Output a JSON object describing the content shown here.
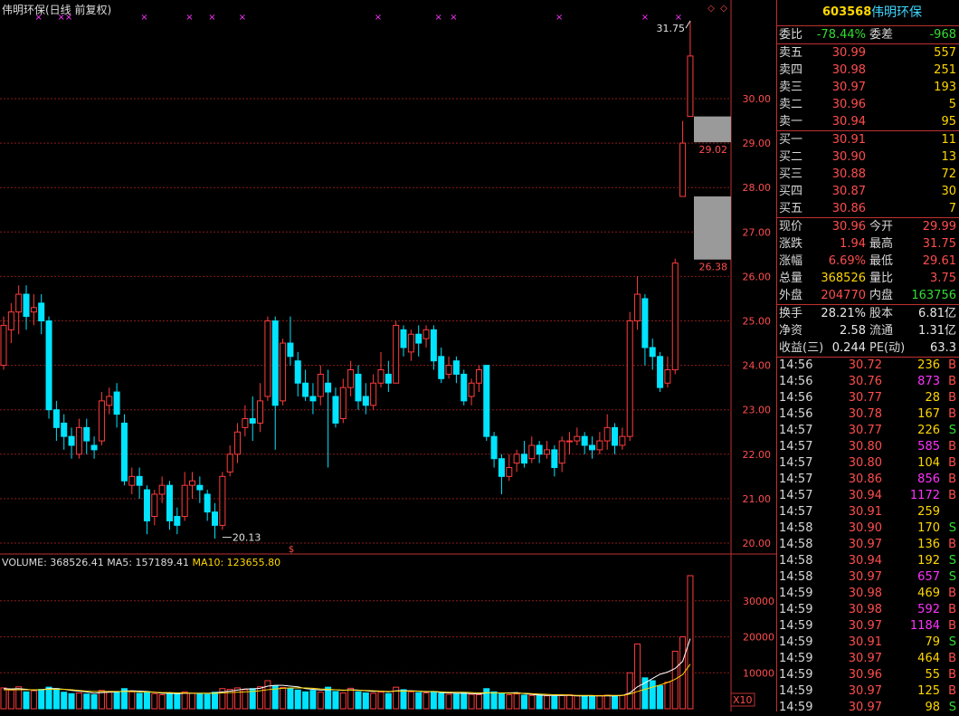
{
  "chart": {
    "title": "伟明环保(日线 前复权)",
    "price_ticks": [
      "30.00",
      "29.00",
      "28.00",
      "27.00",
      "26.00",
      "25.00",
      "24.00",
      "23.00",
      "22.00",
      "21.00",
      "20.00"
    ],
    "volume_ticks": [
      "30000",
      "20000",
      "10000"
    ],
    "volume_unit_label": "X10",
    "high_annotation": "31.75",
    "low_annotation": "20.13",
    "gap_labels": [
      "29.02",
      "26.38"
    ],
    "volume_legend": {
      "volume": "VOLUME: 368526.41",
      "ma5": "MA5: 157189.41",
      "ma10": "MA10: 123655.80"
    },
    "marker_symbol": "×",
    "colors": {
      "up": "#ff3c3c",
      "down": "#00e4ff",
      "grid": "#8a1a1a",
      "ma5": "#ffffff",
      "ma10": "#ffd700",
      "marker": "#ff33ff",
      "gap": "#9a9a9a"
    }
  },
  "chart_data": {
    "type": "candlestick",
    "y_range": [
      19.6,
      32.2
    ],
    "volume_range": [
      0,
      38000
    ],
    "candles": [
      [
        24.0,
        24.9,
        25.1,
        23.9
      ],
      [
        24.8,
        25.2,
        25.4,
        24.5
      ],
      [
        25.2,
        25.6,
        25.8,
        24.7
      ],
      [
        25.6,
        25.1,
        25.8,
        24.8
      ],
      [
        25.2,
        25.3,
        25.6,
        24.9
      ],
      [
        25.4,
        25.0,
        25.6,
        24.7
      ],
      [
        25.0,
        23.0,
        25.1,
        22.8
      ],
      [
        23.0,
        22.6,
        23.2,
        22.3
      ],
      [
        22.7,
        22.4,
        22.9,
        22.1
      ],
      [
        22.4,
        22.2,
        22.6,
        21.9
      ],
      [
        22.0,
        22.6,
        22.8,
        21.9
      ],
      [
        22.6,
        22.3,
        22.8,
        22.0
      ],
      [
        22.2,
        22.1,
        22.4,
        21.9
      ],
      [
        22.3,
        23.2,
        23.4,
        22.2
      ],
      [
        23.1,
        23.3,
        23.5,
        22.9
      ],
      [
        23.4,
        22.9,
        23.6,
        22.6
      ],
      [
        22.7,
        21.4,
        22.9,
        21.3
      ],
      [
        21.3,
        21.5,
        21.7,
        21.1
      ],
      [
        21.5,
        21.3,
        21.7,
        21.0
      ],
      [
        21.2,
        20.5,
        21.3,
        20.2
      ],
      [
        20.6,
        21.1,
        21.2,
        20.4
      ],
      [
        21.1,
        21.3,
        21.5,
        20.9
      ],
      [
        21.3,
        20.5,
        21.4,
        20.3
      ],
      [
        20.6,
        20.4,
        20.8,
        20.2
      ],
      [
        20.6,
        21.3,
        21.6,
        20.5
      ],
      [
        21.3,
        21.4,
        21.6,
        21.0
      ],
      [
        21.3,
        21.2,
        21.5,
        20.9
      ],
      [
        21.1,
        20.7,
        21.2,
        20.5
      ],
      [
        20.7,
        20.4,
        20.9,
        20.1
      ],
      [
        20.4,
        21.5,
        21.6,
        20.3
      ],
      [
        21.6,
        22.0,
        22.2,
        21.5
      ],
      [
        22.0,
        22.5,
        22.7,
        21.8
      ],
      [
        22.6,
        22.8,
        23.1,
        22.4
      ],
      [
        22.8,
        22.7,
        23.3,
        22.3
      ],
      [
        22.7,
        23.2,
        23.6,
        22.5
      ],
      [
        23.3,
        25.0,
        25.1,
        23.2
      ],
      [
        25.0,
        23.1,
        25.1,
        22.1
      ],
      [
        23.2,
        24.5,
        24.6,
        23.1
      ],
      [
        24.5,
        24.2,
        25.1,
        24.0
      ],
      [
        24.1,
        23.6,
        24.3,
        23.3
      ],
      [
        23.6,
        23.3,
        23.9,
        23.2
      ],
      [
        23.3,
        23.2,
        23.6,
        22.9
      ],
      [
        23.3,
        23.8,
        24.0,
        23.1
      ],
      [
        23.6,
        23.4,
        23.9,
        21.7
      ],
      [
        23.3,
        22.7,
        23.5,
        22.6
      ],
      [
        22.8,
        23.5,
        23.7,
        22.7
      ],
      [
        23.5,
        23.9,
        24.1,
        23.3
      ],
      [
        23.8,
        23.2,
        24.0,
        23.0
      ],
      [
        23.3,
        23.1,
        23.6,
        22.9
      ],
      [
        23.1,
        23.6,
        23.8,
        23.0
      ],
      [
        23.6,
        23.9,
        24.3,
        23.5
      ],
      [
        23.8,
        23.6,
        24.1,
        23.4
      ],
      [
        23.6,
        24.9,
        25.0,
        23.6
      ],
      [
        24.8,
        24.4,
        24.9,
        24.2
      ],
      [
        24.3,
        24.7,
        24.8,
        24.1
      ],
      [
        24.7,
        24.5,
        24.9,
        24.2
      ],
      [
        24.6,
        24.8,
        24.9,
        24.4
      ],
      [
        24.8,
        24.1,
        24.9,
        23.9
      ],
      [
        24.2,
        23.7,
        24.4,
        23.6
      ],
      [
        23.8,
        24.0,
        24.2,
        23.7
      ],
      [
        24.1,
        23.8,
        24.2,
        23.6
      ],
      [
        23.8,
        23.2,
        23.9,
        23.1
      ],
      [
        23.3,
        23.6,
        23.7,
        23.1
      ],
      [
        23.6,
        23.9,
        24.0,
        23.4
      ],
      [
        24.0,
        22.4,
        24.0,
        22.3
      ],
      [
        22.4,
        21.9,
        22.5,
        21.7
      ],
      [
        21.9,
        21.5,
        22.0,
        21.1
      ],
      [
        21.5,
        21.7,
        22.0,
        21.4
      ],
      [
        21.8,
        22.0,
        22.1,
        21.6
      ],
      [
        22.0,
        21.8,
        22.3,
        21.7
      ],
      [
        21.9,
        22.2,
        22.4,
        21.8
      ],
      [
        22.2,
        22.0,
        22.3,
        21.8
      ],
      [
        22.0,
        22.1,
        22.3,
        21.9
      ],
      [
        22.1,
        21.7,
        22.2,
        21.5
      ],
      [
        21.8,
        22.3,
        22.4,
        21.6
      ],
      [
        22.3,
        22.3,
        22.5,
        22.0
      ],
      [
        22.3,
        22.4,
        22.6,
        22.2
      ],
      [
        22.4,
        22.2,
        22.5,
        22.0
      ],
      [
        22.2,
        22.1,
        22.4,
        21.9
      ],
      [
        22.1,
        22.3,
        22.5,
        22.0
      ],
      [
        22.3,
        22.6,
        22.9,
        22.1
      ],
      [
        22.6,
        22.2,
        22.7,
        22.0
      ],
      [
        22.2,
        22.4,
        22.6,
        22.1
      ],
      [
        22.4,
        25.0,
        25.2,
        22.3
      ],
      [
        25.0,
        25.6,
        26.0,
        24.8
      ],
      [
        25.5,
        24.4,
        25.6,
        24.0
      ],
      [
        24.4,
        24.2,
        24.6,
        23.9
      ],
      [
        24.2,
        23.5,
        24.3,
        23.4
      ],
      [
        23.6,
        23.9,
        24.2,
        23.5
      ],
      [
        23.9,
        26.3,
        26.4,
        23.8
      ],
      [
        27.8,
        29.0,
        29.5,
        27.8
      ],
      [
        29.6,
        30.96,
        31.75,
        29.61
      ]
    ],
    "volumes": [
      5800,
      5200,
      6100,
      4700,
      5000,
      5400,
      6000,
      5600,
      4600,
      4200,
      4400,
      4100,
      3900,
      5100,
      4800,
      4700,
      5600,
      4700,
      4300,
      4500,
      4200,
      3900,
      4400,
      4100,
      4700,
      4300,
      4100,
      4000,
      4600,
      5600,
      5400,
      5800,
      5300,
      5600,
      6100,
      7800,
      6300,
      5900,
      5600,
      5200,
      4700,
      5100,
      4600,
      6000,
      4800,
      4400,
      5700,
      4700,
      4400,
      4300,
      4600,
      4200,
      6000,
      5300,
      4700,
      4500,
      4400,
      4800,
      4300,
      4000,
      4100,
      4400,
      4000,
      3900,
      5600,
      4700,
      4400,
      3900,
      4100,
      3800,
      3700,
      3900,
      3600,
      3500,
      3700,
      3900,
      3600,
      3400,
      3500,
      3700,
      3800,
      3600,
      3700,
      10000,
      18000,
      8600,
      7800,
      6400,
      7400,
      16000,
      20000,
      37000
    ],
    "ma5": [
      5600,
      5500,
      5600,
      5400,
      5200,
      5300,
      5600,
      5600,
      5400,
      5100,
      4900,
      4700,
      4300,
      4500,
      4600,
      4700,
      4900,
      5000,
      4900,
      4800,
      4600,
      4300,
      4300,
      4200,
      4300,
      4300,
      4300,
      4300,
      4400,
      4700,
      4900,
      5200,
      5500,
      5500,
      5700,
      6300,
      6500,
      6500,
      6300,
      6100,
      5600,
      5400,
      5200,
      5300,
      5300,
      5100,
      5300,
      5200,
      5000,
      4800,
      4900,
      4700,
      5000,
      5000,
      5000,
      4900,
      4700,
      4800,
      4500,
      4400,
      4300,
      4300,
      4200,
      4100,
      4400,
      4400,
      4400,
      4400,
      4500,
      4200,
      4000,
      3800,
      3700,
      3700,
      3700,
      3700,
      3600,
      3600,
      3600,
      3600,
      3600,
      3600,
      3700,
      4400,
      6100,
      7200,
      8400,
      9600,
      10200,
      11200,
      13200,
      19500
    ],
    "ma10": [
      5300,
      5300,
      5300,
      5300,
      5300,
      5300,
      5400,
      5400,
      5400,
      5300,
      5100,
      4900,
      4800,
      4800,
      4800,
      4800,
      4800,
      4800,
      4700,
      4700,
      4600,
      4500,
      4500,
      4400,
      4400,
      4300,
      4300,
      4300,
      4300,
      4400,
      4500,
      4600,
      4700,
      4800,
      5000,
      5300,
      5500,
      5700,
      5800,
      5800,
      5800,
      5700,
      5500,
      5400,
      5300,
      5200,
      5200,
      5100,
      5100,
      5000,
      4900,
      4800,
      4900,
      4900,
      4900,
      4900,
      4800,
      4800,
      4700,
      4600,
      4600,
      4600,
      4500,
      4400,
      4500,
      4400,
      4400,
      4300,
      4300,
      4300,
      4200,
      4100,
      4000,
      3900,
      3900,
      3800,
      3700,
      3700,
      3700,
      3600,
      3700,
      3700,
      3700,
      4100,
      4800,
      5400,
      6000,
      6600,
      7300,
      8200,
      9500,
      12400
    ],
    "markers_at": [
      2,
      5,
      6,
      16,
      22,
      25,
      29,
      47,
      55,
      57,
      71
    ],
    "markers_right": [
      713,
      750
    ]
  },
  "panel": {
    "code": "603568",
    "name": "伟明环保",
    "ratio": {
      "label": "委比",
      "value": "-78.44%",
      "label2": "委差",
      "value2": "-968"
    },
    "asks": [
      {
        "label": "卖五",
        "price": "30.99",
        "vol": "557"
      },
      {
        "label": "卖四",
        "price": "30.98",
        "vol": "251"
      },
      {
        "label": "卖三",
        "price": "30.97",
        "vol": "193"
      },
      {
        "label": "卖二",
        "price": "30.96",
        "vol": "5"
      },
      {
        "label": "卖一",
        "price": "30.94",
        "vol": "95"
      }
    ],
    "bids": [
      {
        "label": "买一",
        "price": "30.91",
        "vol": "11"
      },
      {
        "label": "买二",
        "price": "30.90",
        "vol": "13"
      },
      {
        "label": "买三",
        "price": "30.88",
        "vol": "72"
      },
      {
        "label": "买四",
        "price": "30.87",
        "vol": "30"
      },
      {
        "label": "买五",
        "price": "30.86",
        "vol": "7"
      }
    ],
    "quote": [
      {
        "l1": "现价",
        "v1": "30.96",
        "c1": "red",
        "l2": "今开",
        "v2": "29.99",
        "c2": "red"
      },
      {
        "l1": "涨跌",
        "v1": "1.94",
        "c1": "red",
        "l2": "最高",
        "v2": "31.75",
        "c2": "red"
      },
      {
        "l1": "涨幅",
        "v1": "6.69%",
        "c1": "red",
        "l2": "最低",
        "v2": "29.61",
        "c2": "red"
      },
      {
        "l1": "总量",
        "v1": "368526",
        "c1": "yel",
        "l2": "量比",
        "v2": "3.75",
        "c2": "red"
      },
      {
        "l1": "外盘",
        "v1": "204770",
        "c1": "red",
        "l2": "内盘",
        "v2": "163756",
        "c2": "grn"
      }
    ],
    "fund": [
      {
        "l1": "换手",
        "v1": "28.21%",
        "l2": "股本",
        "v2": "6.81亿"
      },
      {
        "l1": "净资",
        "v1": "2.58",
        "l2": "流通",
        "v2": "1.31亿"
      },
      {
        "l1": "收益(三)",
        "v1": "0.244",
        "l2": "PE(动)",
        "v2": "63.3"
      }
    ],
    "ticks": [
      {
        "time": "14:56",
        "price": "30.72",
        "vol": "236",
        "vc": "yel",
        "side": "B"
      },
      {
        "time": "14:56",
        "price": "30.76",
        "vol": "873",
        "vc": "mag",
        "side": "B"
      },
      {
        "time": "14:56",
        "price": "30.77",
        "vol": "28",
        "vc": "yel",
        "side": "B"
      },
      {
        "time": "14:56",
        "price": "30.78",
        "vol": "167",
        "vc": "yel",
        "side": "B"
      },
      {
        "time": "14:57",
        "price": "30.77",
        "vol": "226",
        "vc": "yel",
        "side": "S"
      },
      {
        "time": "14:57",
        "price": "30.80",
        "vol": "585",
        "vc": "mag",
        "side": "B"
      },
      {
        "time": "14:57",
        "price": "30.80",
        "vol": "104",
        "vc": "yel",
        "side": "B"
      },
      {
        "time": "14:57",
        "price": "30.86",
        "vol": "856",
        "vc": "mag",
        "side": "B"
      },
      {
        "time": "14:57",
        "price": "30.94",
        "vol": "1172",
        "vc": "mag",
        "side": "B"
      },
      {
        "time": "14:57",
        "price": "30.91",
        "vol": "259",
        "vc": "yel",
        "side": ""
      },
      {
        "time": "14:58",
        "price": "30.90",
        "vol": "170",
        "vc": "yel",
        "side": "S"
      },
      {
        "time": "14:58",
        "price": "30.97",
        "vol": "136",
        "vc": "yel",
        "side": "B"
      },
      {
        "time": "14:58",
        "price": "30.94",
        "vol": "192",
        "vc": "yel",
        "side": "S"
      },
      {
        "time": "14:58",
        "price": "30.97",
        "vol": "657",
        "vc": "mag",
        "side": "S"
      },
      {
        "time": "14:59",
        "price": "30.98",
        "vol": "469",
        "vc": "yel",
        "side": "B"
      },
      {
        "time": "14:59",
        "price": "30.98",
        "vol": "592",
        "vc": "mag",
        "side": "B"
      },
      {
        "time": "14:59",
        "price": "30.97",
        "vol": "1184",
        "vc": "mag",
        "side": "B"
      },
      {
        "time": "14:59",
        "price": "30.91",
        "vol": "79",
        "vc": "yel",
        "side": "S"
      },
      {
        "time": "14:59",
        "price": "30.97",
        "vol": "464",
        "vc": "yel",
        "side": "B"
      },
      {
        "time": "14:59",
        "price": "30.96",
        "vol": "55",
        "vc": "yel",
        "side": "B"
      },
      {
        "time": "14:59",
        "price": "30.97",
        "vol": "125",
        "vc": "yel",
        "side": "B"
      },
      {
        "time": "14:59",
        "price": "30.97",
        "vol": "98",
        "vc": "yel",
        "side": "S"
      }
    ]
  }
}
